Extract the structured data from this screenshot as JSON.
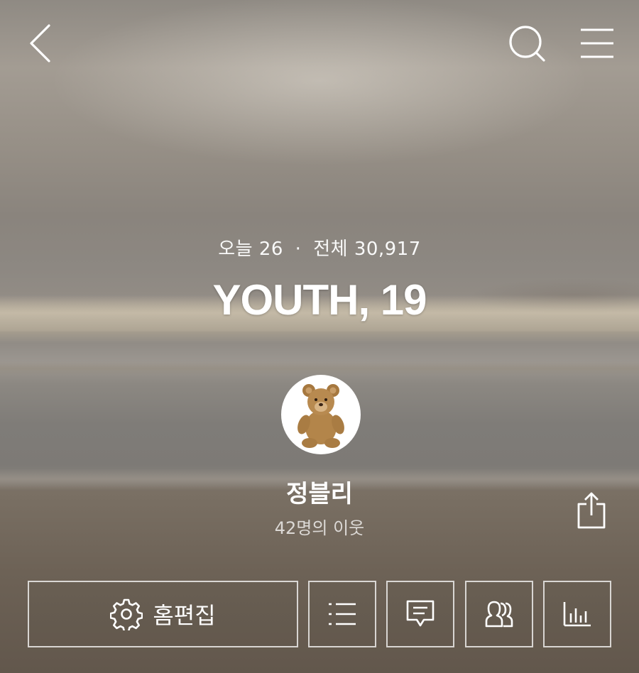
{
  "header": {
    "back_icon": "chevron-left-icon",
    "search_icon": "search-icon",
    "menu_icon": "hamburger-menu-icon"
  },
  "blog": {
    "today_label": "오늘",
    "today_count": "26",
    "separator": "·",
    "total_label": "전체",
    "total_count": "30,917",
    "title": "YOUTH, 19"
  },
  "profile": {
    "avatar_icon": "teddy-bear-avatar",
    "nickname": "정블리",
    "neighbors": "42명의 이웃",
    "share_icon": "share-icon"
  },
  "toolbar": {
    "edit_icon": "gear-icon",
    "edit_label": "홈편집",
    "buttons": [
      "post-list-icon",
      "comment-icon",
      "neighbors-icon",
      "stats-icon"
    ]
  },
  "colors": {
    "foreground": "#ffffff",
    "button_border": "rgba(255,255,255,0.75)"
  }
}
